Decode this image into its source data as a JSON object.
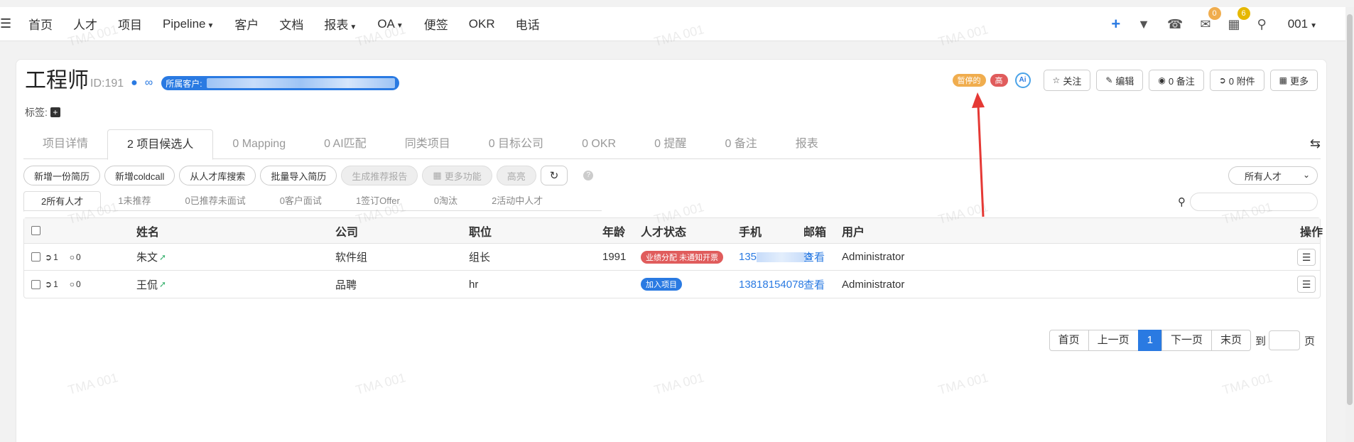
{
  "topnav": {
    "items": [
      "首页",
      "人才",
      "项目",
      "Pipeline",
      "客户",
      "文档",
      "报表",
      "OA",
      "便签",
      "OKR",
      "电话"
    ],
    "mail_badge": "0",
    "calendar_badge": "6",
    "user": "001"
  },
  "header": {
    "title": "工程师",
    "id_text": "ID:191",
    "client_label": "所属客户:",
    "tags_label": "标签:"
  },
  "actions": {
    "paused_tag": "暂停的",
    "priority_tag": "高",
    "ai_label": "Ai",
    "follow": "关注",
    "edit": "编辑",
    "notes": "0 备注",
    "attachments": "0 附件",
    "more": "更多"
  },
  "tabs": [
    "项目详情",
    "2 项目候选人",
    "0 Mapping",
    "0 AI匹配",
    "同类项目",
    "0 目标公司",
    "0 OKR",
    "0 提醒",
    "0 备注",
    "报表"
  ],
  "toolbar": {
    "buttons": [
      "新增一份简历",
      "新增coldcall",
      "从人才库搜索",
      "批量导入简历",
      "生成推荐报告",
      "更多功能",
      "高亮"
    ],
    "filter": "所有人才"
  },
  "subtabs": [
    "2所有人才",
    "1未推荐",
    "0已推荐未面试",
    "0客户面试",
    "1签订Offer",
    "0淘汰",
    "2活动中人才"
  ],
  "table": {
    "headers": [
      "姓名",
      "公司",
      "职位",
      "年龄",
      "人才状态",
      "手机",
      "邮箱",
      "用户",
      "操作"
    ],
    "rows": [
      {
        "attach": "1",
        "comments": "0",
        "name": "朱文",
        "company": "软件组",
        "position": "组长",
        "age": "1991",
        "status": "业绩分配 未通知开票",
        "phone_start": "135",
        "phone_end": "3",
        "email": "查看",
        "user": "Administrator"
      },
      {
        "attach": "1",
        "comments": "0",
        "name": "王侃",
        "company": "品聘",
        "position": "hr",
        "age": "",
        "status": "加入项目",
        "phone": "13818154078",
        "email": "查看",
        "user": "Administrator"
      }
    ]
  },
  "pager": {
    "first": "首页",
    "prev": "上一页",
    "current": "1",
    "next": "下一页",
    "last": "末页",
    "goto": "到",
    "page": "页"
  },
  "watermark": "TMA 001",
  "colors": {
    "accent": "#2a7ae2",
    "orange": "#f0ad4e",
    "red": "#e05c5c",
    "annotation": "#e53935"
  }
}
